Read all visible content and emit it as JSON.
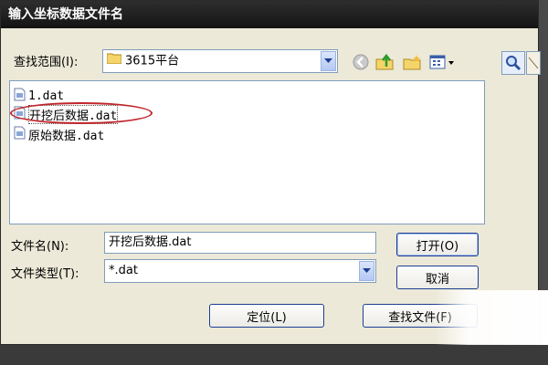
{
  "dialog": {
    "title": "输入坐标数据文件名"
  },
  "look_in": {
    "label": "查找范围(I):",
    "value": "3615平台"
  },
  "toolbar": {
    "back_icon": "back-arrow-icon",
    "up_icon": "up-folder-icon",
    "new_folder_icon": "new-folder-icon",
    "view_icon": "view-menu-icon"
  },
  "right_tools": {
    "search_icon": "magnifier-icon",
    "preview_icon": "preview-icon"
  },
  "files": [
    {
      "name": "1.dat",
      "icon": "dat-file-icon"
    },
    {
      "name": "开挖后数据.dat",
      "icon": "dat-file-icon",
      "highlighted": true
    },
    {
      "name": "原始数据.dat",
      "icon": "dat-file-icon"
    }
  ],
  "file_name": {
    "label": "文件名(N):",
    "value": "开挖后数据.dat"
  },
  "file_type": {
    "label": "文件类型(T):",
    "value": "*.dat"
  },
  "buttons": {
    "open": "打开(O)",
    "cancel": "取消",
    "locate": "定位(L)",
    "find_file": "查找文件(F)"
  },
  "colors": {
    "title_bar": "#1e1e1e",
    "dialog_bg": "#ece9d8",
    "highlight_ring": "#c0262c",
    "border": "#7f9db9"
  }
}
